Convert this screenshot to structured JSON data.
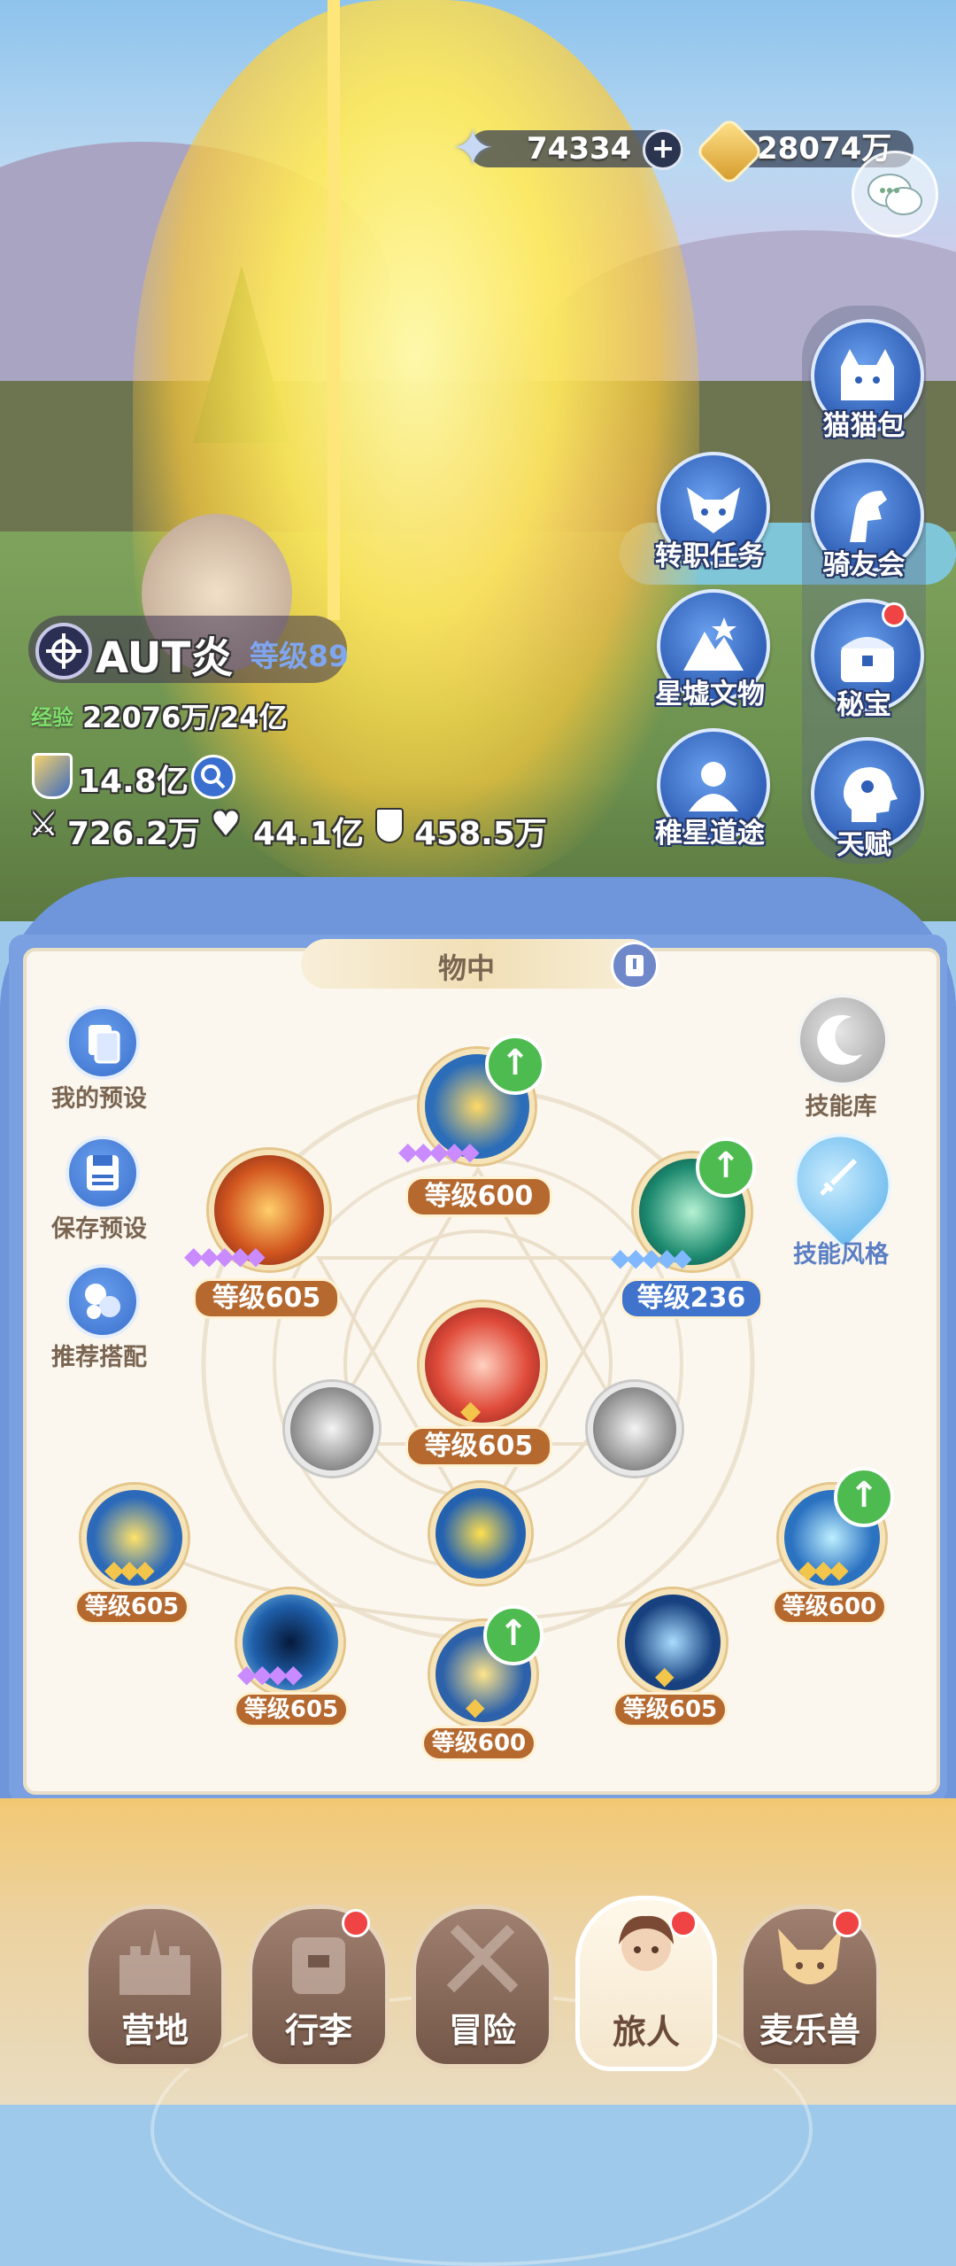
{
  "currency": {
    "stars": "74334",
    "gold": "28074万",
    "add_label": "+"
  },
  "menu": {
    "cat_bag": "猫猫包",
    "riders": "骑友会",
    "job_change": "转职任务",
    "relics": "星墟文物",
    "treasure": "秘宝",
    "path": "稚星道途",
    "talent": "天赋"
  },
  "player": {
    "name": "AUT炎",
    "level": "等级89",
    "exp_label": "经验",
    "exp_value": "22076万/24亿",
    "power": "14.8亿",
    "attack": "726.2万",
    "hp": "44.1亿",
    "defense": "458.5万"
  },
  "panel": {
    "title": "物中",
    "my_preset": "我的预设",
    "save_preset": "保存预设",
    "recommend": "推荐搭配",
    "skill_library": "技能库",
    "skill_style": "技能风格",
    "skills": [
      {
        "level": "等级600"
      },
      {
        "level": "等级605"
      },
      {
        "level": "等级236"
      },
      {
        "level": "等级605"
      },
      {
        "level": "等级605"
      },
      {
        "level": "等级600"
      },
      {
        "level": "等级605"
      },
      {
        "level": "等级600"
      },
      {
        "level": "等级605"
      }
    ]
  },
  "nav": {
    "camp": "营地",
    "luggage": "行李",
    "adventure": "冒险",
    "traveler": "旅人",
    "pets": "麦乐兽"
  },
  "colors": {
    "panel_blue": "#7aa0e2",
    "level_brown": "#b5692f",
    "level_blue": "#3f73cc",
    "upgrade_green": "#4dbb4f"
  }
}
